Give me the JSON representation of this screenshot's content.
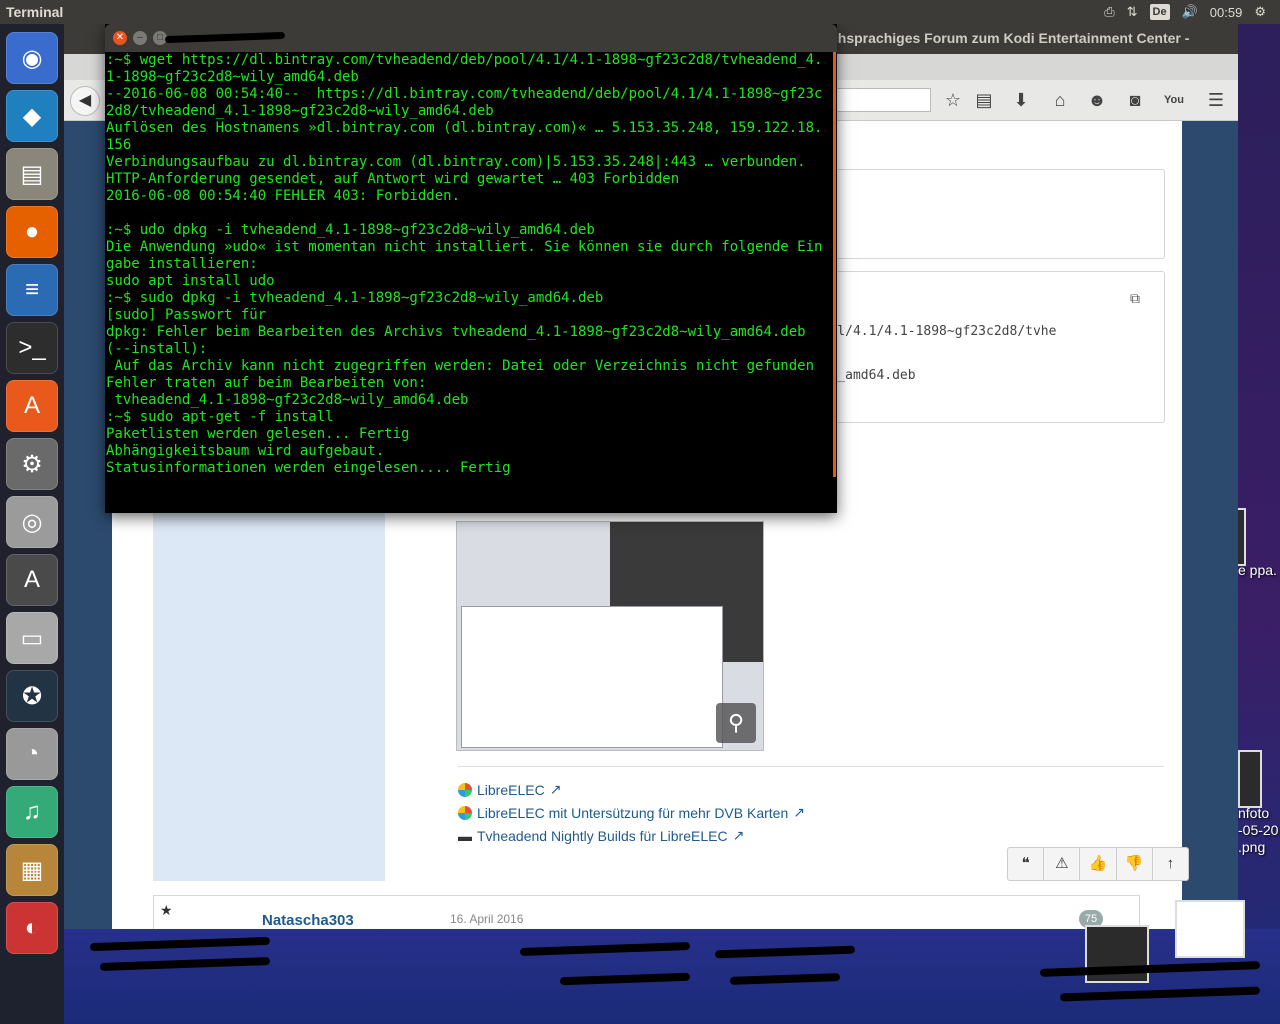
{
  "top_panel": {
    "title": "Terminal",
    "indicators": {
      "printer_icon": "printer-icon",
      "network_icon": "network-arrows-icon",
      "keyboard_layout": "De",
      "volume_icon": "speaker-icon",
      "clock": "00:59",
      "gear_icon": "gear-icon"
    }
  },
  "launcher": {
    "items": [
      {
        "name": "ubuntu-dash",
        "glyph": "◉",
        "color": "#3a6ccd"
      },
      {
        "name": "kodi",
        "glyph": "◆",
        "color": "#1f7fbf"
      },
      {
        "name": "files",
        "glyph": "▤",
        "color": "#8a8679"
      },
      {
        "name": "firefox",
        "glyph": "●",
        "color": "#e66000"
      },
      {
        "name": "libreoffice-writer",
        "glyph": "≡",
        "color": "#2a6bb3"
      },
      {
        "name": "terminal",
        "glyph": ">_",
        "color": "#2d2d2d"
      },
      {
        "name": "software-center",
        "glyph": "A",
        "color": "#e9591c"
      },
      {
        "name": "system-settings",
        "glyph": "⚙",
        "color": "#6a6a6a"
      },
      {
        "name": "camera",
        "glyph": "◎",
        "color": "#9b9b9b"
      },
      {
        "name": "software-updater",
        "glyph": "A",
        "color": "#4a4a4a"
      },
      {
        "name": "disk",
        "glyph": "▭",
        "color": "#a8a8a8"
      },
      {
        "name": "orb-app",
        "glyph": "✪",
        "color": "#234"
      },
      {
        "name": "disk-usage",
        "glyph": "◔",
        "color": "#999"
      },
      {
        "name": "music-app",
        "glyph": "♫",
        "color": "#3a7"
      },
      {
        "name": "archive",
        "glyph": "▦",
        "color": "#b8863b"
      },
      {
        "name": "misc-app",
        "glyph": "◐",
        "color": "#c33"
      }
    ]
  },
  "browser": {
    "title": "chsprachiges Forum zum Kodi Entertainment Center -",
    "toolbar_icons": [
      "star-icon",
      "reading-list-icon",
      "download-icon",
      "home-icon",
      "smiley-icon",
      "pocket-icon",
      "youtube-icon",
      "menu-icon"
    ],
    "code_box": {
      "line1": "/pool/4.1/4.1-1898~gf23c2d8/tvhe",
      "line2": "wily_amd64.deb"
    },
    "links": [
      {
        "text": "LibreELEC",
        "icon": "libreelec-icon"
      },
      {
        "text": "LibreELEC mit Untersützung für mehr DVB Karten",
        "icon": "libreelec-icon"
      },
      {
        "text": "Tvheadend Nightly Builds für LibreELEC",
        "icon": "folder-icon"
      }
    ],
    "actions": [
      "❝",
      "⚠",
      "👍",
      "👎",
      "↑"
    ],
    "next_post": {
      "author": "Natascha303",
      "date": "16. April 2016",
      "number": "75"
    }
  },
  "terminal": {
    "lines": [
      ":~$ wget https://dl.bintray.com/tvheadend/deb/pool/4.1/4.1-1898~gf23c2d8/tvheadend_4.1-1898~gf23c2d8~wily_amd64.deb",
      "--2016-06-08 00:54:40--  https://dl.bintray.com/tvheadend/deb/pool/4.1/4.1-1898~gf23c2d8/tvheadend_4.1-1898~gf23c2d8~wily_amd64.deb",
      "Auflösen des Hostnamens »dl.bintray.com (dl.bintray.com)« … 5.153.35.248, 159.122.18.156",
      "Verbindungsaufbau zu dl.bintray.com (dl.bintray.com)|5.153.35.248|:443 … verbunden.",
      "HTTP-Anforderung gesendet, auf Antwort wird gewartet … 403 Forbidden",
      "2016-06-08 00:54:40 FEHLER 403: Forbidden.",
      "",
      ":~$ udo dpkg -i tvheadend_4.1-1898~gf23c2d8~wily_amd64.deb",
      "Die Anwendung »udo« ist momentan nicht installiert. Sie können sie durch folgende Eingabe installieren:",
      "sudo apt install udo",
      ":~$ sudo dpkg -i tvheadend_4.1-1898~gf23c2d8~wily_amd64.deb",
      "[sudo] Passwort für",
      "dpkg: Fehler beim Bearbeiten des Archivs tvheadend_4.1-1898~gf23c2d8~wily_amd64.deb (--install):",
      " Auf das Archiv kann nicht zugegriffen werden: Datei oder Verzeichnis nicht gefunden",
      "Fehler traten auf beim Bearbeiten von:",
      " tvheadend_4.1-1898~gf23c2d8~wily_amd64.deb",
      ":~$ sudo apt-get -f install",
      "Paketlisten werden gelesen... Fertig",
      "Abhängigkeitsbaum wird aufgebaut.",
      "Statusinformationen werden eingelesen.... Fertig"
    ]
  },
  "desktop": {
    "labels": [
      {
        "text": "e ppa."
      },
      {
        "text": "nfoto"
      },
      {
        "text": "-05-20"
      },
      {
        "text": ".png"
      }
    ]
  }
}
